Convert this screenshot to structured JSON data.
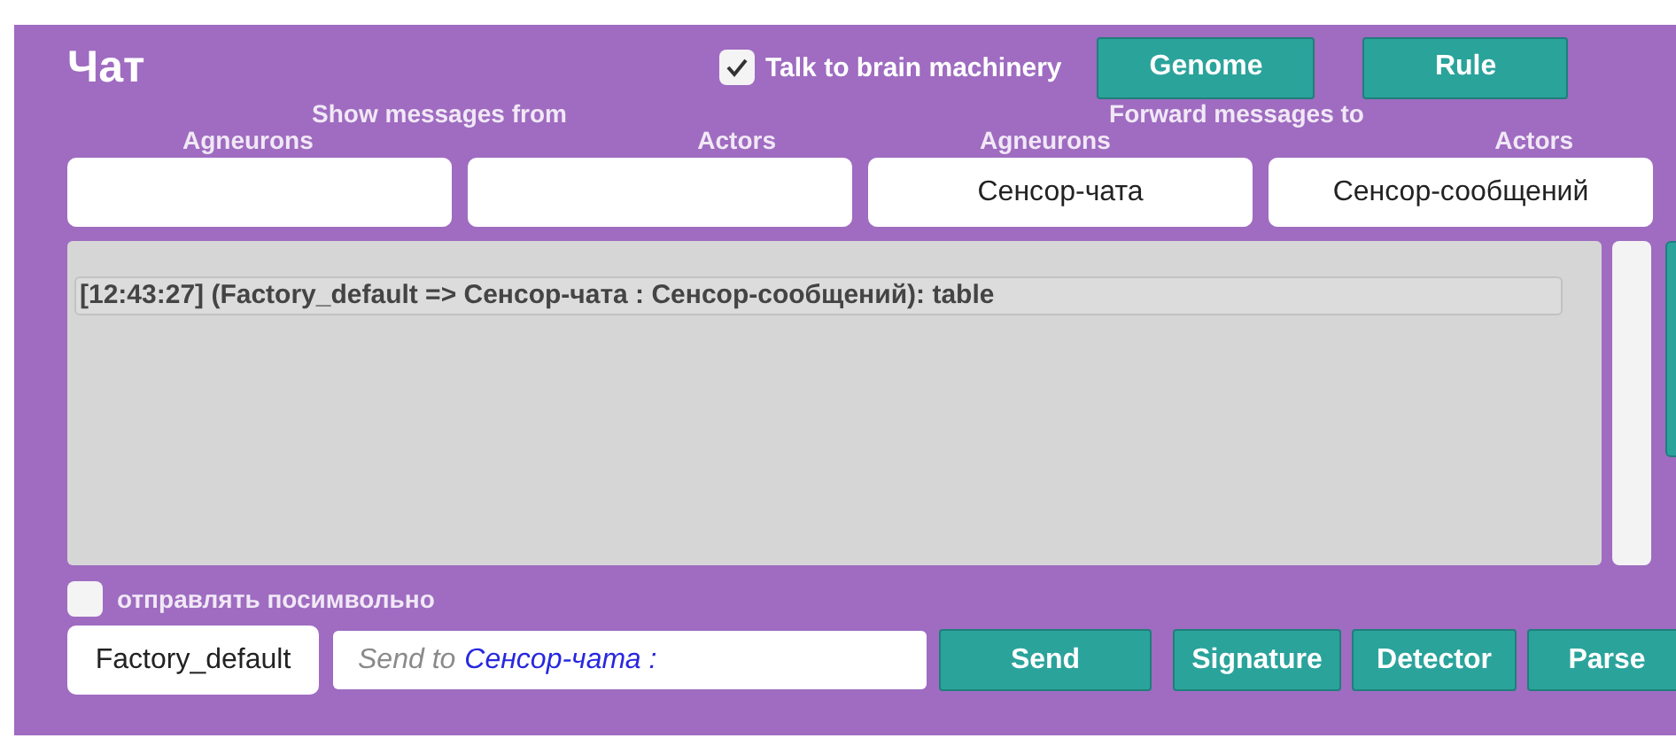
{
  "title": "Чат",
  "talk_to_brain": {
    "label": "Talk to brain machinery",
    "checked": true
  },
  "top_buttons": [
    "Genome",
    "Rule"
  ],
  "show_from": {
    "heading": "Show messages from",
    "columns": [
      {
        "label": "Agneurons"
      },
      {
        "label": "Actors"
      }
    ]
  },
  "forward_to": {
    "heading": "Forward messages to",
    "columns": [
      {
        "label": "Agneurons",
        "value": "Сенсор-чата"
      },
      {
        "label": "Actors",
        "value": "Сенсор-сообщений"
      }
    ]
  },
  "log": [
    "[12:43:27] (Factory_default => Сенсор-чата : Сенсор-сообщений): table"
  ],
  "per_char": {
    "label": "отправлять посимвольно",
    "checked": false
  },
  "sender": "Factory_default",
  "message_field": {
    "placeholder": "Send to",
    "recipient": "Сенсор-чата :"
  },
  "send_button": "Send",
  "bottom_buttons": [
    "Signature",
    "Detector",
    "Parse"
  ]
}
